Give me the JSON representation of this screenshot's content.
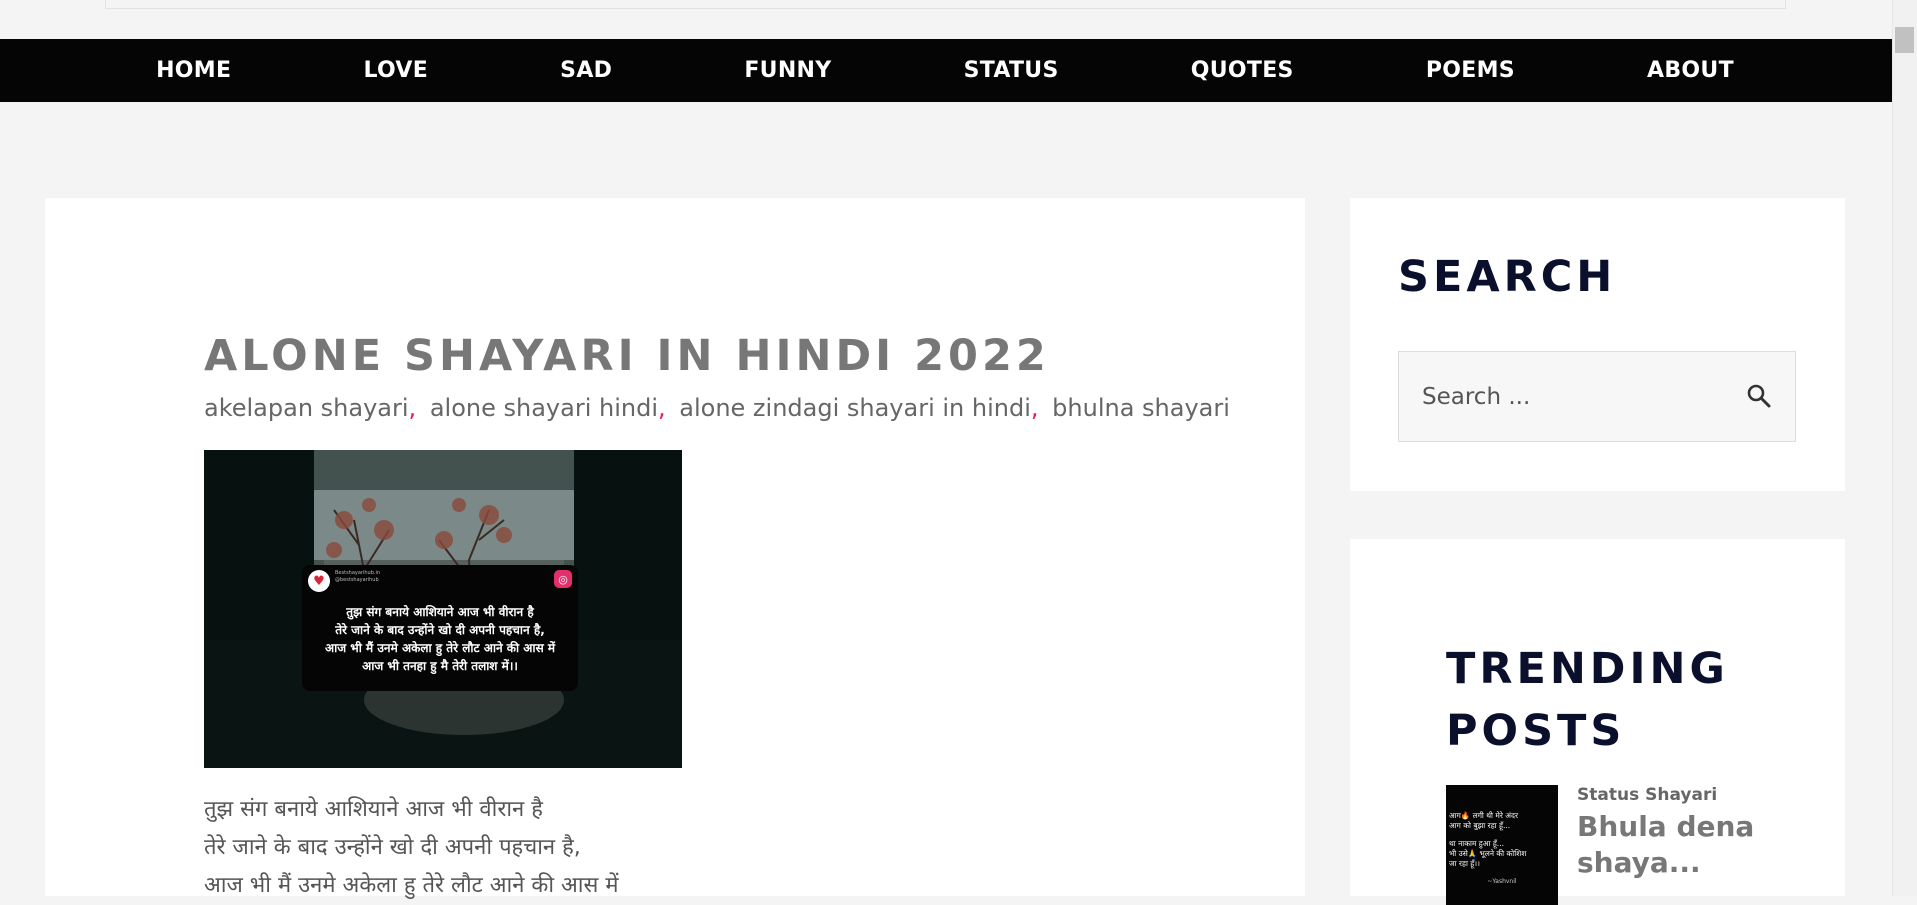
{
  "nav": {
    "items": [
      "HOME",
      "LOVE",
      "SAD",
      "FUNNY",
      "STATUS",
      "QUOTES",
      "POEMS",
      "ABOUT"
    ]
  },
  "post": {
    "title": "ALONE SHAYARI IN HINDI 2022",
    "tags": [
      "akelapan shayari",
      "alone shayari hindi",
      "alone zindagi shayari in hindi",
      "bhulna shayari"
    ],
    "tag_separator": ",",
    "image": {
      "card_handle": "Bestshayarihub.in",
      "card_subhandle": "@bestshayarihub",
      "card_lines": [
        "तुझ संग बनाये आशियाने आज भी वीरान है",
        "तेरे जाने के बाद उन्होंने खो दी अपनी पहचान है,",
        "आज भी मैं उनमे अकेला हु तेरे लौट आने की आस में",
        "आज भी तनहा हु मै तेरी तलाश में।।"
      ]
    },
    "body_lines": [
      "तुझ संग बनाये आशियाने आज भी वीरान है",
      "तेरे जाने के बाद उन्होंने खो दी अपनी पहचान है,",
      "आज भी मैं उनमे अकेला हु तेरे लौट आने की आस में"
    ]
  },
  "sidebar": {
    "search": {
      "title": "SEARCH",
      "placeholder": "Search ..."
    },
    "trending": {
      "title": "TRENDING POSTS",
      "items": [
        {
          "category": "Status Shayari",
          "title": "Bhula dena shaya...",
          "thumb_lines": [
            "आग🔥 लगी थी मेरे अंदर",
            "आग को बुझा रहा हूँ...",
            "",
            "था नाकाम हुआ हूँ...",
            "भी उसे🙏 भूलने की कोशिश",
            "जा रहा हूँ।।"
          ],
          "thumb_attrib": "~Yashvnil"
        }
      ]
    }
  },
  "colors": {
    "nav_bg": "#050505",
    "page_bg": "#f4f4f4",
    "title_grey": "#777777",
    "heading_navy": "#0a0f2c",
    "tag_separator": "#e61d4f"
  }
}
